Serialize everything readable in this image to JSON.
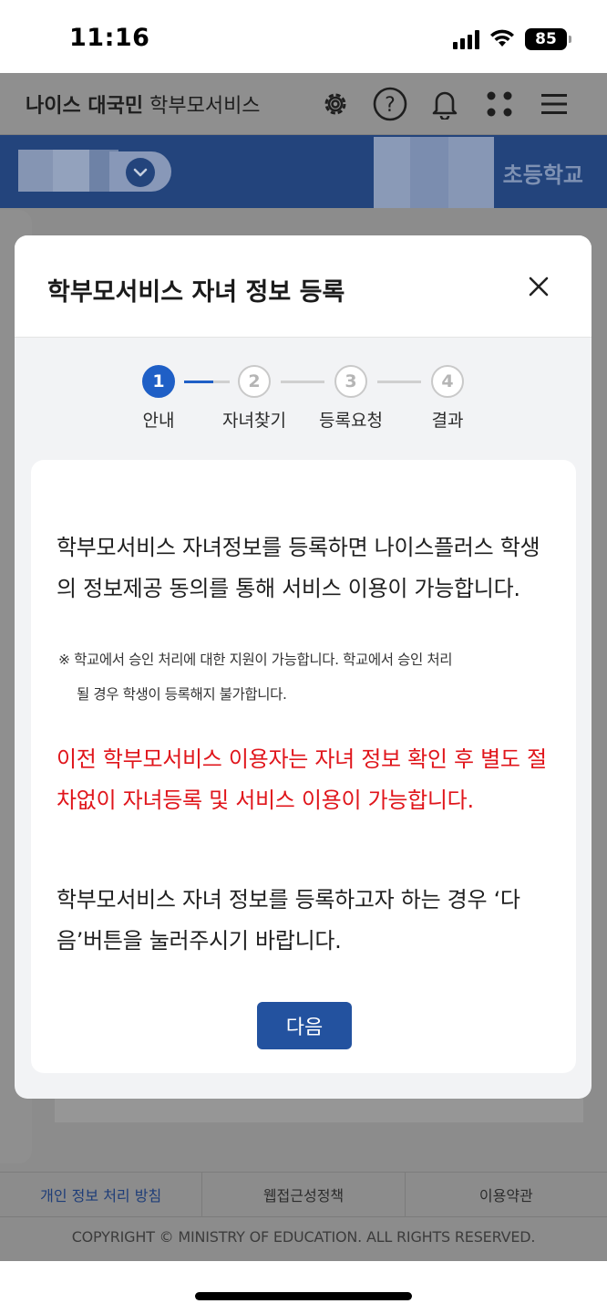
{
  "status_bar": {
    "time": "11:16",
    "battery": "85"
  },
  "app_header": {
    "brand_bold": "나이스 대국민",
    "brand_service": " 학부모서비스",
    "icons": [
      "gear-icon",
      "help-icon",
      "bell-icon",
      "apps-icon",
      "menu-icon"
    ]
  },
  "school_bar": {
    "school_name": "초등학교"
  },
  "modal": {
    "title": "학부모서비스 자녀 정보 등록",
    "close_label": "×",
    "steps": [
      {
        "number": "1",
        "label": "안내"
      },
      {
        "number": "2",
        "label": "자녀찾기"
      },
      {
        "number": "3",
        "label": "등록요청"
      },
      {
        "number": "4",
        "label": "결과"
      }
    ],
    "active_step": 1,
    "intro_text": "학부모서비스 자녀정보를 등록하면 나이스플러스 학생의 정보제공 동의를 통해 서비스 이용이 가능합니다.",
    "note_line1": "※ 학교에서 승인 처리에 대한 지원이 가능합니다. 학교에서 승인 처리",
    "note_line2": "될 경우 학생이 등록해지 불가합니다.",
    "red_text": "이전 학부모서비스 이용자는 자녀 정보 확인 후 별도 절차없이 자녀등록 및 서비스 이용이 가능합니다.",
    "next_text": "학부모서비스 자녀 정보를 등록하고자 하는 경우 ‘다음’버튼을 눌러주시기 바랍니다.",
    "next_button": "다음"
  },
  "footer": {
    "links": [
      "개인 정보 처리 방침",
      "웹접근성정책",
      "이용약관"
    ],
    "copyright": "COPYRIGHT © MINISTRY OF EDUCATION. ALL RIGHTS RESERVED."
  },
  "colors": {
    "primary": "#1f5fc6",
    "button": "#23529f",
    "warning_red": "#e0151b",
    "school_bar": "#23447c"
  }
}
